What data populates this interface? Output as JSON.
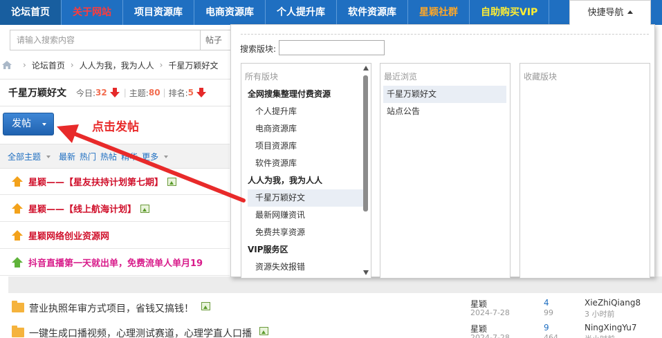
{
  "nav": {
    "items": [
      {
        "label": "论坛首页",
        "color": "#ffffff"
      },
      {
        "label": "关于网站",
        "color": "#ff3b3b"
      },
      {
        "label": "项目资源库",
        "color": "#ffffff"
      },
      {
        "label": "电商资源库",
        "color": "#ffffff"
      },
      {
        "label": "个人提升库",
        "color": "#ffffff"
      },
      {
        "label": "软件资源库",
        "color": "#ffffff"
      },
      {
        "label": "星颖社群",
        "color": "#ffa726"
      },
      {
        "label": "自助购买VIP",
        "color": "#ffee33"
      }
    ],
    "quick_nav": "快捷导航"
  },
  "search": {
    "placeholder": "请输入搜索内容",
    "type": "帖子"
  },
  "breadcrumb": [
    "论坛首页",
    "人人为我，我为人人",
    "千星万颖好文"
  ],
  "forum": {
    "name": "千星万颖好文",
    "today_label": "今日:",
    "today": "32",
    "topics_label": "主题:",
    "topics": "80",
    "rank_label": "排名:",
    "rank": "5"
  },
  "post_button": "发帖",
  "annotation": "点击发帖",
  "filter": [
    "全部主题",
    "最新",
    "热门",
    "热帖",
    "精华",
    "更多"
  ],
  "threads": [
    {
      "title": "星颖——【星友扶持计划第七期】",
      "color": "#d0102b",
      "icon_color": "#f3a21b"
    },
    {
      "title": "星颖——【线上航海计划】",
      "color": "#d0102b",
      "icon_color": "#f3a21b"
    },
    {
      "title": "星颖网络创业资源网",
      "color": "#d0102b",
      "icon_color": "#f3a21b"
    },
    {
      "title": "抖音直播第一天就出单，免费流单人单月19",
      "color": "#d81b8a",
      "icon_color": "#5fb33a"
    }
  ],
  "bottom_threads": [
    {
      "title": "营业执照年审方式项目，省钱又搞钱！",
      "author": "星颖",
      "date": "2024-7-28",
      "replies": "4",
      "views": "99",
      "last": "XieZhiQiang8",
      "last_time": "3 小时前"
    },
    {
      "title": "一键生成口播视频，心理测试赛道，心理学直人口播",
      "author": "星颖",
      "date": "2024-7-28",
      "replies": "9",
      "views": "464",
      "last": "NingXingYu7",
      "last_time": "半小时前"
    }
  ],
  "panel": {
    "search_label": "搜索版块:",
    "columns": [
      "所有版块",
      "最近浏览",
      "收藏版块"
    ],
    "all_forums": [
      {
        "label": "全网搜集整理付费资源",
        "kind": "grp"
      },
      {
        "label": "个人提升库",
        "kind": "sub"
      },
      {
        "label": "电商资源库",
        "kind": "sub"
      },
      {
        "label": "项目资源库",
        "kind": "sub"
      },
      {
        "label": "软件资源库",
        "kind": "sub"
      },
      {
        "label": "人人为我，我为人人",
        "kind": "grp"
      },
      {
        "label": "千星万颖好文",
        "kind": "sub",
        "selected": true
      },
      {
        "label": "最新网赚资讯",
        "kind": "sub"
      },
      {
        "label": "免费共享资源",
        "kind": "sub"
      },
      {
        "label": "VIP服务区",
        "kind": "grp"
      },
      {
        "label": "资源失效报错",
        "kind": "sub"
      }
    ],
    "recent": [
      "千星万颖好文",
      "站点公告"
    ]
  }
}
